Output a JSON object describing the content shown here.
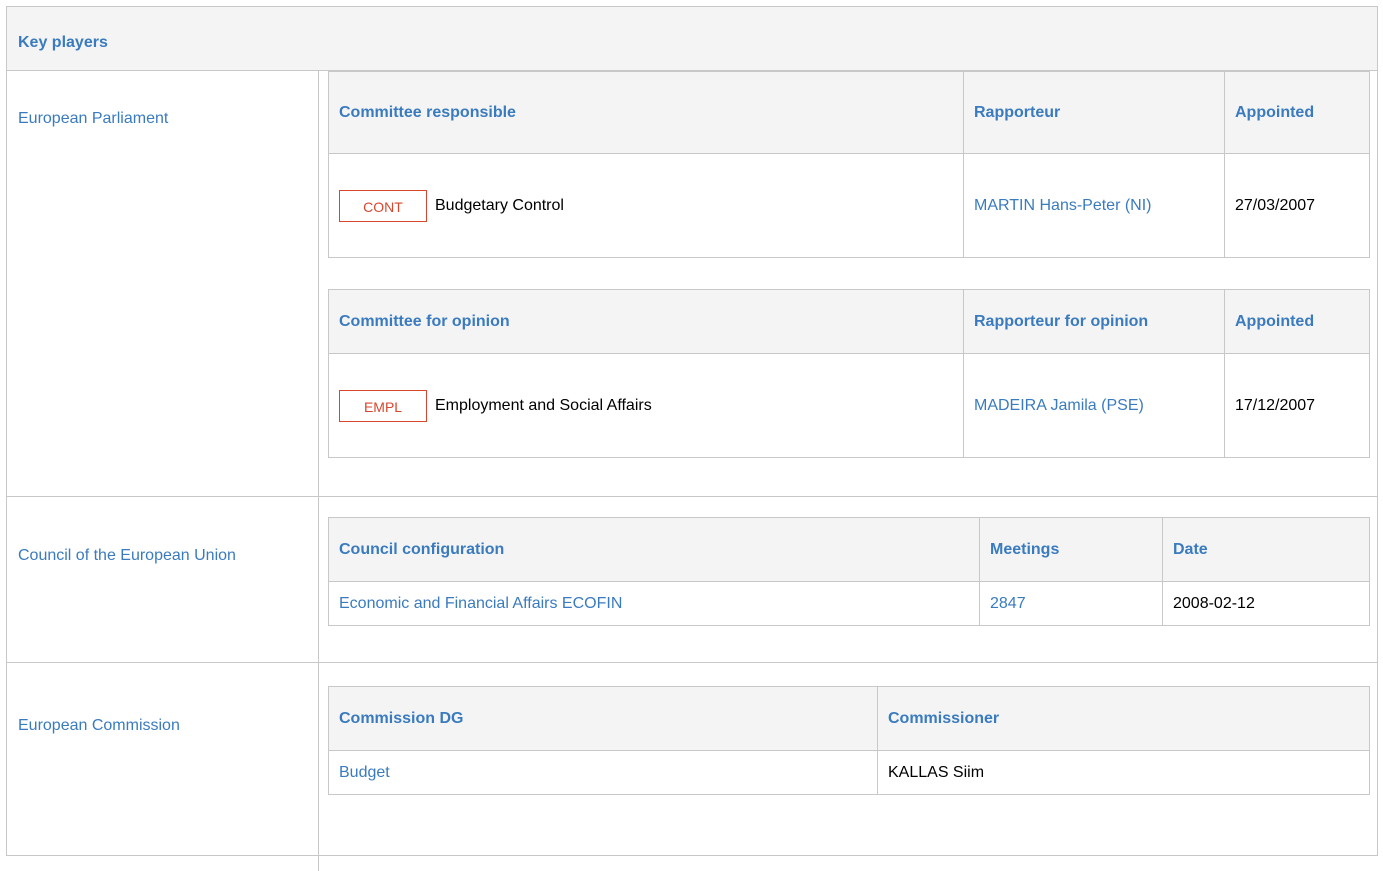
{
  "section_title": "Key players",
  "ep": {
    "label": "European Parliament",
    "responsible": {
      "headers": [
        "Committee responsible",
        "Rapporteur",
        "Appointed"
      ],
      "row": {
        "code": "CONT",
        "name": "Budgetary Control",
        "rapporteur": "MARTIN Hans-Peter (NI)",
        "appointed": "27/03/2007"
      }
    },
    "opinion": {
      "headers": [
        "Committee for opinion",
        "Rapporteur for opinion",
        "Appointed"
      ],
      "row": {
        "code": "EMPL",
        "name": "Employment and Social Affairs",
        "rapporteur": "MADEIRA Jamila (PSE)",
        "appointed": "17/12/2007"
      }
    }
  },
  "council": {
    "label": "Council of the European Union",
    "headers": [
      "Council configuration",
      "Meetings",
      "Date"
    ],
    "row": {
      "configuration": "Economic and Financial Affairs ECOFIN",
      "meeting": "2847",
      "date": "2008-02-12"
    }
  },
  "commission": {
    "label": "European Commission",
    "headers": [
      "Commission DG",
      "Commissioner"
    ],
    "row": {
      "dg": "Budget",
      "commissioner": "KALLAS Siim"
    }
  },
  "colors": {
    "link": "#3a7bbf",
    "badge": "#d9462e",
    "border": "#c8c8c8",
    "header_bg": "#f4f4f4"
  }
}
